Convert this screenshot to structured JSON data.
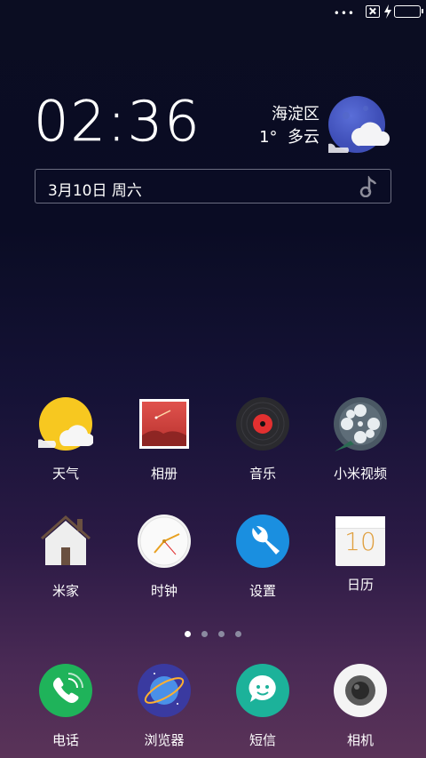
{
  "status_bar": {
    "dots": "•••"
  },
  "clock": {
    "time": "02:36"
  },
  "weather": {
    "district": "海淀区",
    "temp": "1°",
    "condition": "多云"
  },
  "date": {
    "text": "3月10日 周六"
  },
  "apps": [
    {
      "label": "天气"
    },
    {
      "label": "相册"
    },
    {
      "label": "音乐"
    },
    {
      "label": "小米视频"
    },
    {
      "label": "米家"
    },
    {
      "label": "时钟"
    },
    {
      "label": "设置"
    },
    {
      "label": "日历",
      "icon_text": "10"
    }
  ],
  "dock": [
    {
      "label": "电话"
    },
    {
      "label": "浏览器"
    },
    {
      "label": "短信"
    },
    {
      "label": "相机"
    }
  ],
  "page_indicator": {
    "pages": 4,
    "active": 1
  },
  "colors": {
    "battery": "#2ecc40",
    "phone": "#1fb35a",
    "settings": "#1a8fe0",
    "sms": "#1cb29a",
    "browser": "#3a3aa0"
  }
}
